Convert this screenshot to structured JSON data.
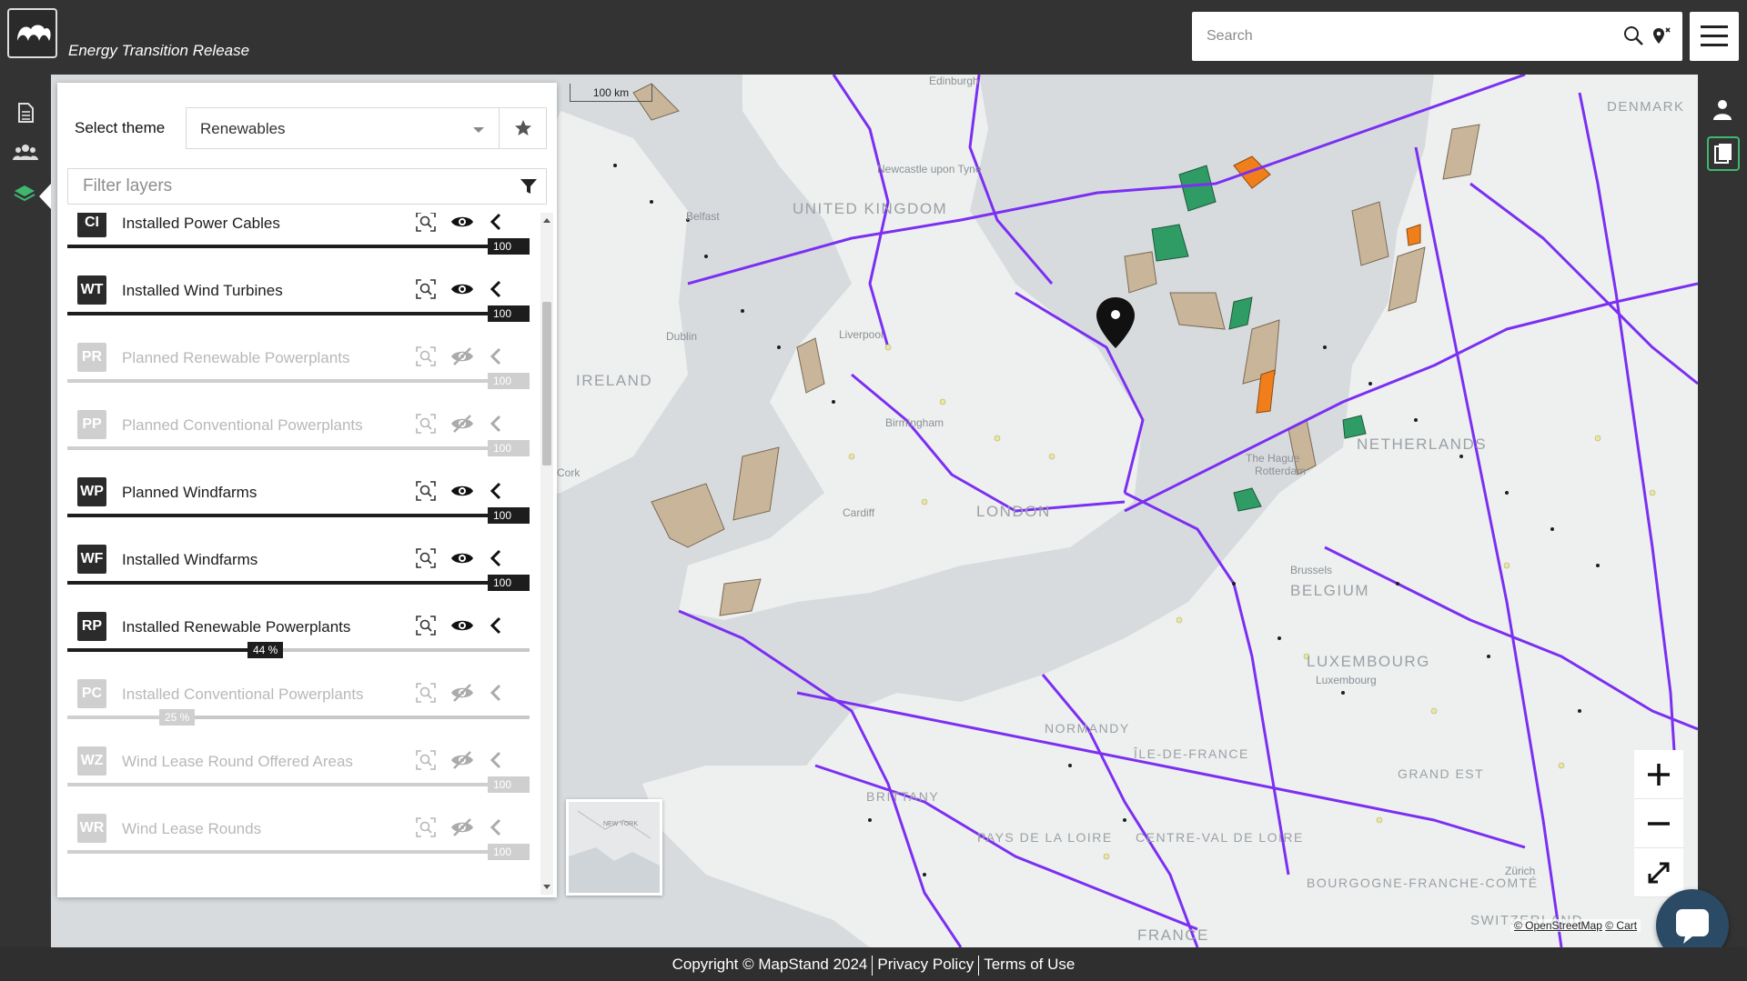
{
  "header": {
    "app_title": "Energy Transition Release",
    "search_placeholder": "Search",
    "logo_icon": "mapstand-logo-icon"
  },
  "left_rail": {
    "icons": [
      "document-icon",
      "users-icon",
      "layers-icon"
    ]
  },
  "right_rail": {
    "icons": [
      "user-icon",
      "clipboard-icon"
    ]
  },
  "panel": {
    "theme_label": "Select theme",
    "theme_value": "Renewables",
    "filter_placeholder": "Filter layers",
    "layers": [
      {
        "code": "CI",
        "name": "Installed Power Cables",
        "opacity_label": "100 %",
        "opacity": 1.0,
        "visible": true
      },
      {
        "code": "WT",
        "name": "Installed Wind Turbines",
        "opacity_label": "100 %",
        "opacity": 1.0,
        "visible": true
      },
      {
        "code": "PR",
        "name": "Planned Renewable Powerplants",
        "opacity_label": "100 %",
        "opacity": 1.0,
        "visible": false
      },
      {
        "code": "PP",
        "name": "Planned Conventional Powerplants",
        "opacity_label": "100 %",
        "opacity": 1.0,
        "visible": false
      },
      {
        "code": "WP",
        "name": "Planned Windfarms",
        "opacity_label": "100 %",
        "opacity": 1.0,
        "visible": true
      },
      {
        "code": "WF",
        "name": "Installed Windfarms",
        "opacity_label": "100 %",
        "opacity": 1.0,
        "visible": true
      },
      {
        "code": "RP",
        "name": "Installed Renewable Powerplants",
        "opacity_label": "44 %",
        "opacity": 0.44,
        "visible": true
      },
      {
        "code": "PC",
        "name": "Installed Conventional Powerplants",
        "opacity_label": "25 %",
        "opacity": 0.25,
        "visible": false
      },
      {
        "code": "WZ",
        "name": "Wind Lease Round Offered Areas",
        "opacity_label": "100 %",
        "opacity": 1.0,
        "visible": false
      },
      {
        "code": "WR",
        "name": "Wind Lease Rounds",
        "opacity_label": "100 %",
        "opacity": 1.0,
        "visible": false
      }
    ]
  },
  "map": {
    "scale_label": "100 km",
    "place_labels": [
      "UNITED KINGDOM",
      "IRELAND",
      "Dublin",
      "Belfast",
      "Liverpool",
      "Birmingham",
      "LONDON",
      "Cardiff",
      "Cork",
      "Newcastle upon Tyne",
      "Edinburgh",
      "NETHERLANDS",
      "The Hague",
      "Rotterdam",
      "BELGIUM",
      "Brussels",
      "LUXEMBOURG",
      "Luxembourg",
      "NORMANDY",
      "ÎLE-DE-FRANCE",
      "BRITTANY",
      "PAYS DE LA LOIRE",
      "CENTRE-VAL DE LOIRE",
      "BOURGOGNE-FRANCHE-COMTÉ",
      "FRANCE",
      "GRAND EST",
      "DENMARK",
      "Zürich",
      "SWITZERLAND"
    ],
    "minimap_label": "NEW YORK",
    "zoom_in": "+",
    "zoom_out": "−",
    "fullscreen_icon": "expand-icon",
    "attribution_osm": "© OpenStreetMap",
    "attribution_carto": "© Cart",
    "colors": {
      "cables": "#7b2ff2",
      "lease_areas": "#c8b59a",
      "windfarm_installed": "#2e9c64",
      "windfarm_planned": "#f07f1b",
      "turbines": "#1e1e1e",
      "renewables": "#e9e6a0"
    }
  },
  "footer": {
    "copyright": "Copyright © MapStand 2024",
    "privacy": "Privacy Policy",
    "terms": "Terms of Use"
  }
}
